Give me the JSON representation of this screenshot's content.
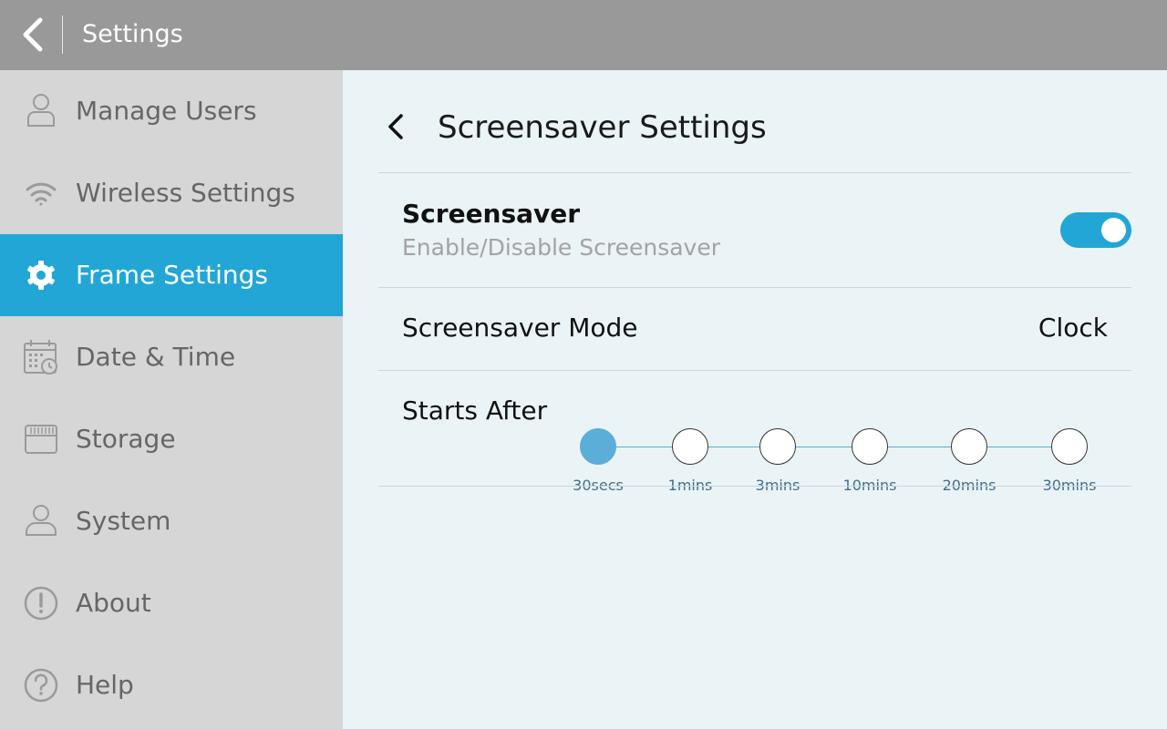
{
  "topbar": {
    "title": "Settings"
  },
  "sidebar": {
    "items": [
      {
        "label": "Manage Users",
        "icon": "user-lock-icon",
        "active": false
      },
      {
        "label": "Wireless Settings",
        "icon": "wifi-icon",
        "active": false
      },
      {
        "label": "Frame Settings",
        "icon": "gear-icon",
        "active": true
      },
      {
        "label": "Date & Time",
        "icon": "calendar-clock-icon",
        "active": false
      },
      {
        "label": "Storage",
        "icon": "sd-card-icon",
        "active": false
      },
      {
        "label": "System",
        "icon": "person-icon",
        "active": false
      },
      {
        "label": "About",
        "icon": "info-icon",
        "active": false
      },
      {
        "label": "Help",
        "icon": "help-icon",
        "active": false
      }
    ]
  },
  "content": {
    "title": "Screensaver Settings",
    "screensaver": {
      "title": "Screensaver",
      "subtitle": "Enable/Disable Screensaver",
      "enabled": true
    },
    "mode": {
      "label": "Screensaver Mode",
      "value": "Clock"
    },
    "starts_after": {
      "label": "Starts After",
      "options": [
        "30secs",
        "1mins",
        "3mins",
        "10mins",
        "20mins",
        "30mins"
      ],
      "selected": "30secs"
    }
  },
  "colors": {
    "accent": "#22a6d6",
    "stepper_accent": "#5aaed8",
    "sidebar_bg": "#d6d6d6",
    "topbar_bg": "#999999",
    "content_bg": "#eaf3f6"
  }
}
